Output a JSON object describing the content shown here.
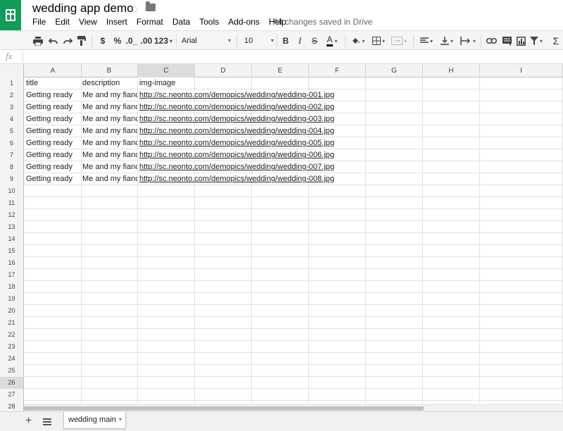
{
  "app": {
    "doc_title": "wedding app demo",
    "save_status": "All changes saved in Drive",
    "accent_color": "#0f9d58",
    "selection_color": "#4285f4"
  },
  "menu": [
    "File",
    "Edit",
    "View",
    "Insert",
    "Format",
    "Data",
    "Tools",
    "Add-ons",
    "Help"
  ],
  "toolbar": {
    "print_icon": "print-icon",
    "currency_label": "$",
    "percent_label": "%",
    "decrease_decimals_label": ".0_",
    "increase_decimals_label": ".00",
    "more_formats_label": "123",
    "font_name": "Arial",
    "font_size": "10",
    "bold_label": "B",
    "italic_label": "I",
    "strike_label": "S",
    "text_color_label": "A",
    "sum_label": "Σ"
  },
  "formula_bar": {
    "fx_label": "fx",
    "value": ""
  },
  "grid": {
    "columns": [
      "A",
      "B",
      "C",
      "D",
      "E",
      "F",
      "G",
      "H",
      "I"
    ],
    "selected_column": "C",
    "selected_row": "26",
    "row_numbers": [
      "1",
      "2",
      "3",
      "4",
      "5",
      "6",
      "7",
      "8",
      "9",
      "10",
      "11",
      "12",
      "13",
      "14",
      "15",
      "16",
      "17",
      "18",
      "19",
      "20",
      "21",
      "22",
      "23",
      "24",
      "25",
      "26",
      "27",
      "28"
    ],
    "rows": [
      [
        "title",
        "description",
        "img-image"
      ],
      [
        "Getting ready",
        "Me and my fianc",
        "http://sc.neonto.com/demopics/wedding/wedding-001.jpg"
      ],
      [
        "Getting ready",
        "Me and my fianc",
        "http://sc.neonto.com/demopics/wedding/wedding-002.jpg"
      ],
      [
        "Getting ready",
        "Me and my fianc",
        "http://sc.neonto.com/demopics/wedding/wedding-003.jpg"
      ],
      [
        "Getting ready",
        "Me and my fianc",
        "http://sc.neonto.com/demopics/wedding/wedding-004.jpg"
      ],
      [
        "Getting ready",
        "Me and my fianc",
        "http://sc.neonto.com/demopics/wedding/wedding-005.jpg"
      ],
      [
        "Getting ready",
        "Me and my fianc",
        "http://sc.neonto.com/demopics/wedding/wedding-006.jpg"
      ],
      [
        "Getting ready",
        "Me and my fianc",
        "http://sc.neonto.com/demopics/wedding/wedding-007.jpg"
      ],
      [
        "Getting ready",
        "Me and my fianc",
        "http://sc.neonto.com/demopics/wedding/wedding-008.jpg"
      ]
    ]
  },
  "sheets": {
    "active_tab": "wedding main",
    "add_label": "+"
  }
}
